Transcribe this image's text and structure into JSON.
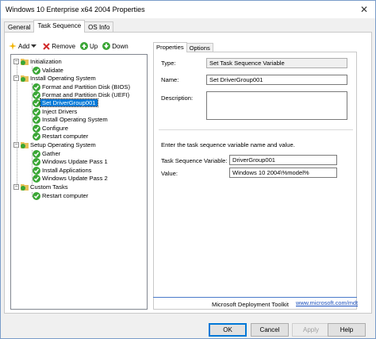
{
  "window": {
    "title": "Windows 10 Enterprise x64 2004 Properties",
    "close_glyph": "✕"
  },
  "tabs": [
    {
      "label": "General",
      "active": false
    },
    {
      "label": "Task Sequence",
      "active": true
    },
    {
      "label": "OS Info",
      "active": false
    }
  ],
  "toolbar": {
    "add_label": "Add",
    "remove_label": "Remove",
    "up_label": "Up",
    "down_label": "Down",
    "icons": {
      "add": "sparkle-add-icon",
      "remove": "red-x-icon",
      "up": "green-up-arrow-icon",
      "down": "green-down-arrow-icon"
    }
  },
  "tree": {
    "items": [
      {
        "label": "Initialization",
        "type": "group",
        "level": 0
      },
      {
        "label": "Validate",
        "type": "step",
        "level": 1
      },
      {
        "label": "Install Operating System",
        "type": "group",
        "level": 0
      },
      {
        "label": "Format and Partition Disk (BIOS)",
        "type": "step",
        "level": 1
      },
      {
        "label": "Format and Partition Disk (UEFI)",
        "type": "step",
        "level": 1
      },
      {
        "label": "Set DriverGroup001",
        "type": "step",
        "level": 1,
        "selected": true
      },
      {
        "label": "Inject Drivers",
        "type": "step",
        "level": 1
      },
      {
        "label": "Install Operating System",
        "type": "step",
        "level": 1
      },
      {
        "label": "Configure",
        "type": "step",
        "level": 1
      },
      {
        "label": "Restart computer",
        "type": "step",
        "level": 1
      },
      {
        "label": "Setup Operating System",
        "type": "group",
        "level": 0
      },
      {
        "label": "Gather",
        "type": "step",
        "level": 1
      },
      {
        "label": "Windows Update Pass 1",
        "type": "step",
        "level": 1
      },
      {
        "label": "Install Applications",
        "type": "step",
        "level": 1
      },
      {
        "label": "Windows Update Pass 2",
        "type": "step",
        "level": 1
      },
      {
        "label": "Custom Tasks",
        "type": "group",
        "level": 0
      },
      {
        "label": "Restart computer",
        "type": "step",
        "level": 1
      }
    ],
    "expander_glyph": "−"
  },
  "properties": {
    "tabs": [
      {
        "label": "Properties",
        "active": true
      },
      {
        "label": "Options",
        "active": false
      }
    ],
    "type_label": "Type:",
    "type_value": "Set Task Sequence Variable",
    "name_label": "Name:",
    "name_value": "Set DriverGroup001",
    "description_label": "Description:",
    "description_value": "",
    "instruction": "Enter the task sequence variable name and value.",
    "variable_label": "Task Sequence Variable:",
    "variable_value": "DriverGroup001",
    "value_label": "Value:",
    "value_value": "Windows 10 2004\\%model%",
    "footer_text": "Microsoft Deployment Toolkit",
    "footer_link": "www.microsoft.com/mdt"
  },
  "buttons": {
    "ok": "OK",
    "cancel": "Cancel",
    "apply": "Apply",
    "help": "Help"
  },
  "colors": {
    "selection": "#0078d7",
    "check": "#3aa635",
    "folder": "#e8c25a",
    "link": "#1a4fbd"
  }
}
